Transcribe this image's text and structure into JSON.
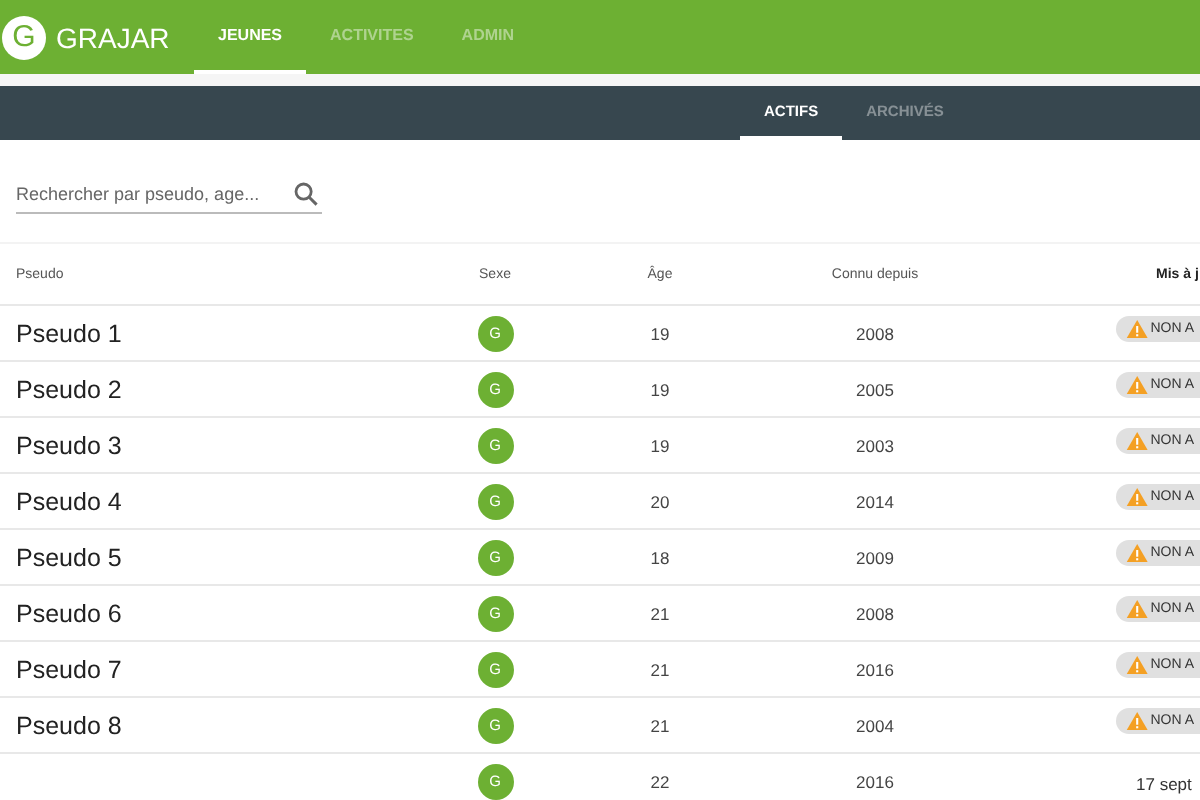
{
  "app": {
    "logo_letter": "G",
    "name": "GRAJAR"
  },
  "nav_tabs": [
    {
      "label": "JEUNES",
      "selected": true
    },
    {
      "label": "ACTIVITES",
      "selected": false
    },
    {
      "label": "ADMIN",
      "selected": false
    }
  ],
  "sub_tabs": [
    {
      "label": "ACTIFS",
      "selected": true
    },
    {
      "label": "ARCHIVÉS",
      "selected": false
    }
  ],
  "search": {
    "placeholder": "Rechercher par pseudo, age..."
  },
  "table": {
    "columns": [
      "Pseudo",
      "Sexe",
      "Âge",
      "Connu depuis",
      "Mis à j"
    ],
    "rows": [
      {
        "pseudo": "Pseudo 1",
        "sexe": "G",
        "age": "19",
        "connu": "2008",
        "update": {
          "kind": "warning",
          "text": "NON A"
        }
      },
      {
        "pseudo": "Pseudo 2",
        "sexe": "G",
        "age": "19",
        "connu": "2005",
        "update": {
          "kind": "warning",
          "text": "NON A"
        }
      },
      {
        "pseudo": "Pseudo 3",
        "sexe": "G",
        "age": "19",
        "connu": "2003",
        "update": {
          "kind": "warning",
          "text": "NON A"
        }
      },
      {
        "pseudo": "Pseudo 4",
        "sexe": "G",
        "age": "20",
        "connu": "2014",
        "update": {
          "kind": "warning",
          "text": "NON A"
        }
      },
      {
        "pseudo": "Pseudo 5",
        "sexe": "G",
        "age": "18",
        "connu": "2009",
        "update": {
          "kind": "warning",
          "text": "NON A"
        }
      },
      {
        "pseudo": "Pseudo 6",
        "sexe": "G",
        "age": "21",
        "connu": "2008",
        "update": {
          "kind": "warning",
          "text": "NON A"
        }
      },
      {
        "pseudo": "Pseudo 7",
        "sexe": "G",
        "age": "21",
        "connu": "2016",
        "update": {
          "kind": "warning",
          "text": "NON A"
        }
      },
      {
        "pseudo": "Pseudo 8",
        "sexe": "G",
        "age": "21",
        "connu": "2004",
        "update": {
          "kind": "warning",
          "text": "NON A"
        }
      },
      {
        "sexe": "G",
        "age": "22",
        "connu": "2016",
        "update": {
          "kind": "date",
          "text": "17 sept"
        }
      }
    ]
  }
}
